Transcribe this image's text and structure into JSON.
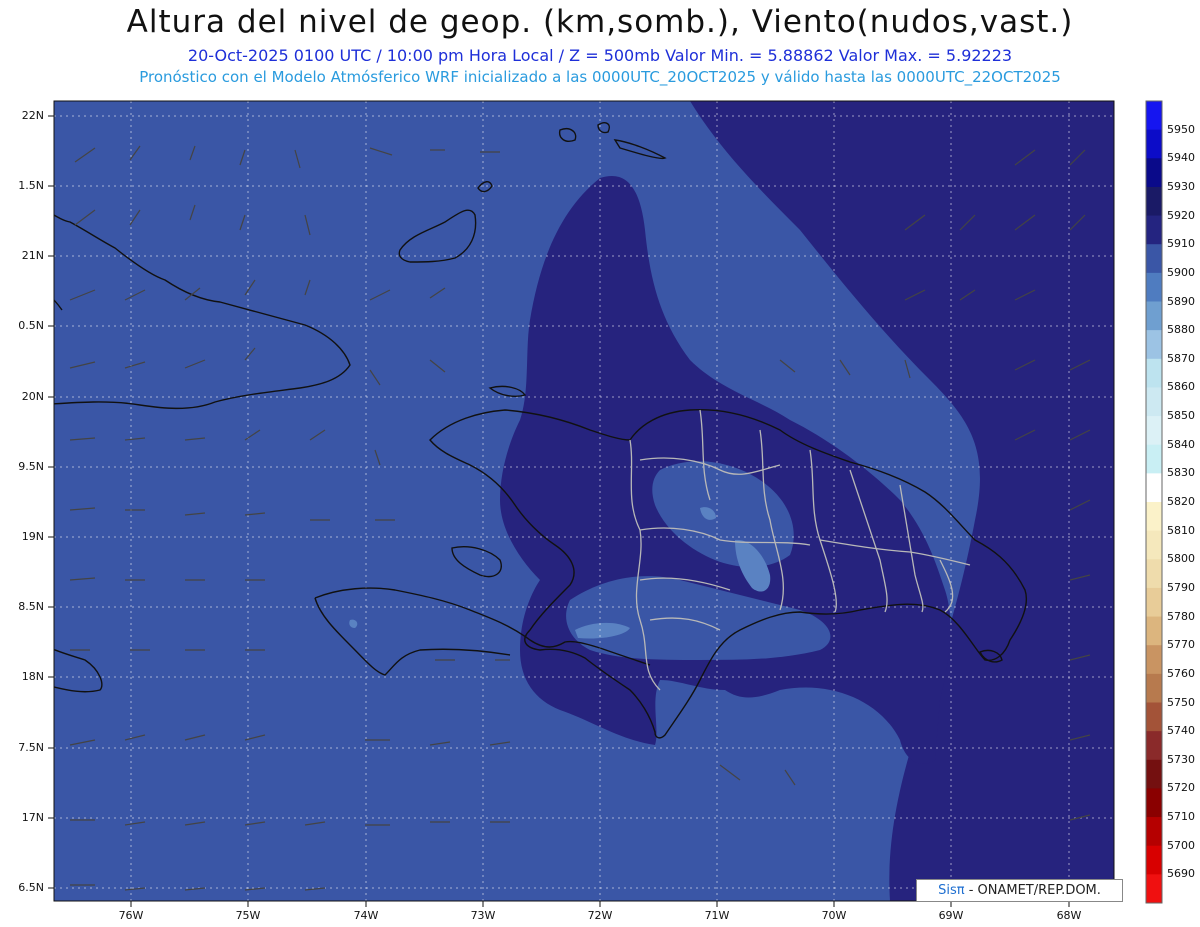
{
  "header": {
    "title": "Altura del nivel de geop. (km,somb.), Viento(nudos,vast.)",
    "subtitle_line1": "20-Oct-2025  0100 UTC / 10:00 pm Hora Local / Z = 500mb    Valor Min. = 5.88862  Valor Max. = 5.92223",
    "subtitle_line2": "Pronóstico con el Modelo Atmósferico WRF inicializado a las 0000UTC_20OCT2025 y válido hasta las  0000UTC_22OCT2025"
  },
  "map": {
    "lat_labels": [
      "22N",
      "1.5N",
      "21N",
      "0.5N",
      "20N",
      "9.5N",
      "19N",
      "8.5N",
      "18N",
      "7.5N",
      "17N",
      "6.5N"
    ],
    "lon_labels": [
      "76W",
      "75W",
      "74W",
      "73W",
      "72W",
      "71W",
      "70W",
      "69W",
      "68W"
    ],
    "colors": {
      "background_5900": "#3a56a6",
      "mid_5910": "#26237e",
      "light_5890": "#5a82c2",
      "coast": "#111111",
      "province_borders": "#b8b8b8"
    }
  },
  "colorbar": {
    "levels": [
      "5950",
      "5940",
      "5930",
      "5920",
      "5910",
      "5900",
      "5890",
      "5880",
      "5870",
      "5860",
      "5850",
      "5840",
      "5830",
      "5820",
      "5810",
      "5800",
      "5790",
      "5780",
      "5770",
      "5760",
      "5750",
      "5740",
      "5730",
      "5720",
      "5710",
      "5700",
      "5690"
    ],
    "colors": [
      "#1515f0",
      "#0c0cc8",
      "#0a0a8a",
      "#1a1a66",
      "#242480",
      "#3a56a6",
      "#4f7cc0",
      "#6f9fd0",
      "#9cc3e4",
      "#bde3ef",
      "#cde9f2",
      "#dcf1f6",
      "#c9eff4",
      "#ffffff",
      "#fbf2c9",
      "#f5e8bc",
      "#efdcac",
      "#e8cc98",
      "#dcb57e",
      "#c99462",
      "#b77a4e",
      "#a35338",
      "#8a2a2a",
      "#741010",
      "#8a0000",
      "#b50000",
      "#d80000",
      "#f01010"
    ]
  },
  "credit": {
    "sis": "Sisπ",
    "org": " - ONAMET/REP.DOM."
  }
}
